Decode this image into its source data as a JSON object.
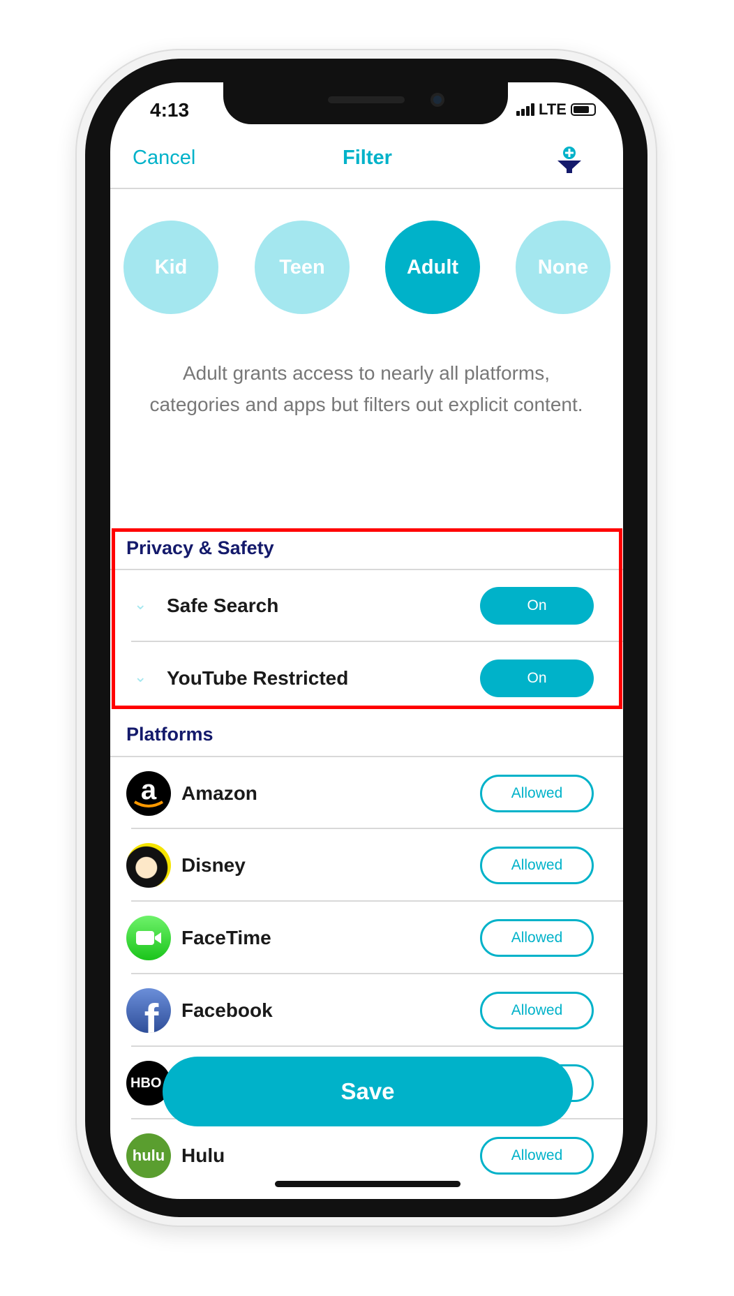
{
  "status_bar": {
    "time": "4:13",
    "network": "LTE"
  },
  "header": {
    "cancel_label": "Cancel",
    "title": "Filter",
    "icon": "add-filter-icon"
  },
  "levels": [
    {
      "label": "Kid",
      "selected": false
    },
    {
      "label": "Teen",
      "selected": false
    },
    {
      "label": "Adult",
      "selected": true
    },
    {
      "label": "None",
      "selected": false
    }
  ],
  "description": "Adult grants access to nearly all platforms, categories and apps but filters out explicit content.",
  "privacy": {
    "title": "Privacy & Safety",
    "items": [
      {
        "label": "Safe Search",
        "state": "On"
      },
      {
        "label": "YouTube Restricted",
        "state": "On"
      }
    ]
  },
  "platforms": {
    "title": "Platforms",
    "items": [
      {
        "name": "Amazon",
        "state": "Allowed"
      },
      {
        "name": "Disney",
        "state": "Allowed"
      },
      {
        "name": "FaceTime",
        "state": "Allowed"
      },
      {
        "name": "Facebook",
        "state": "Allowed"
      },
      {
        "logo_text": "HBO"
      },
      {
        "name": "Hulu",
        "state": "Allowed",
        "logo_text": "hulu"
      }
    ]
  },
  "save_label": "Save",
  "colors": {
    "accent": "#00b2c9",
    "accent_light": "#a4e7ef",
    "section_title": "#141a6b",
    "highlight": "#ff0000"
  }
}
